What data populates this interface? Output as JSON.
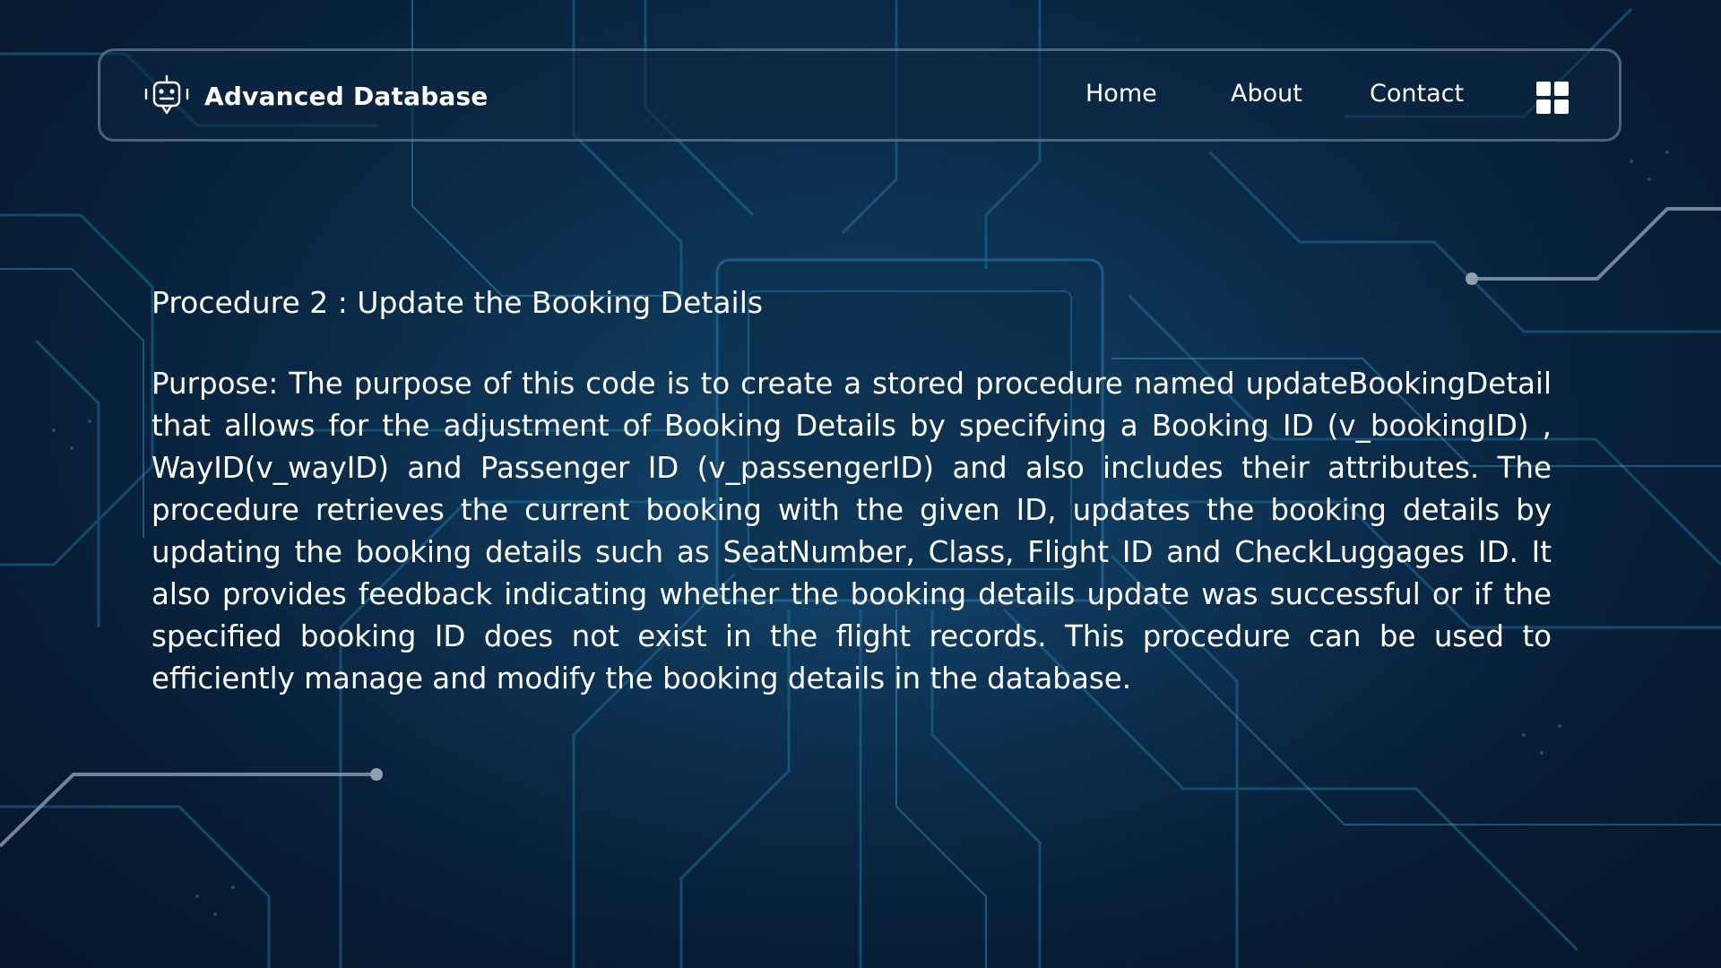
{
  "header": {
    "brand_name": "Advanced Database",
    "brand_icon": "robot-icon",
    "nav": [
      {
        "label": "Home"
      },
      {
        "label": "About"
      },
      {
        "label": "Contact"
      }
    ],
    "menu_icon": "grid-icon"
  },
  "main": {
    "title": "Procedure 2 : Update the Booking Details",
    "purpose": "Purpose: The purpose of this code is to create a stored procedure named updateBookingDetail that allows for the adjustment of Booking Details by specifying a Booking ID (v_bookingID) , WayID(v_wayID) and Passenger ID (v_passengerID) and also includes their attributes. The procedure retrieves the current booking with the given ID, updates the booking details by updating the booking details such as SeatNumber, Class, Flight ID and CheckLuggages ID. It also provides feedback indicating whether the booking details update was successful or if the specified booking ID does not exist in the flight records. This procedure can be used to efficiently manage and modify the booking details in the database."
  },
  "colors": {
    "background": "#0a2a48",
    "circuit": "#1f6f9a",
    "accent_line": "#8fa0b0",
    "text": "#ffffff"
  }
}
